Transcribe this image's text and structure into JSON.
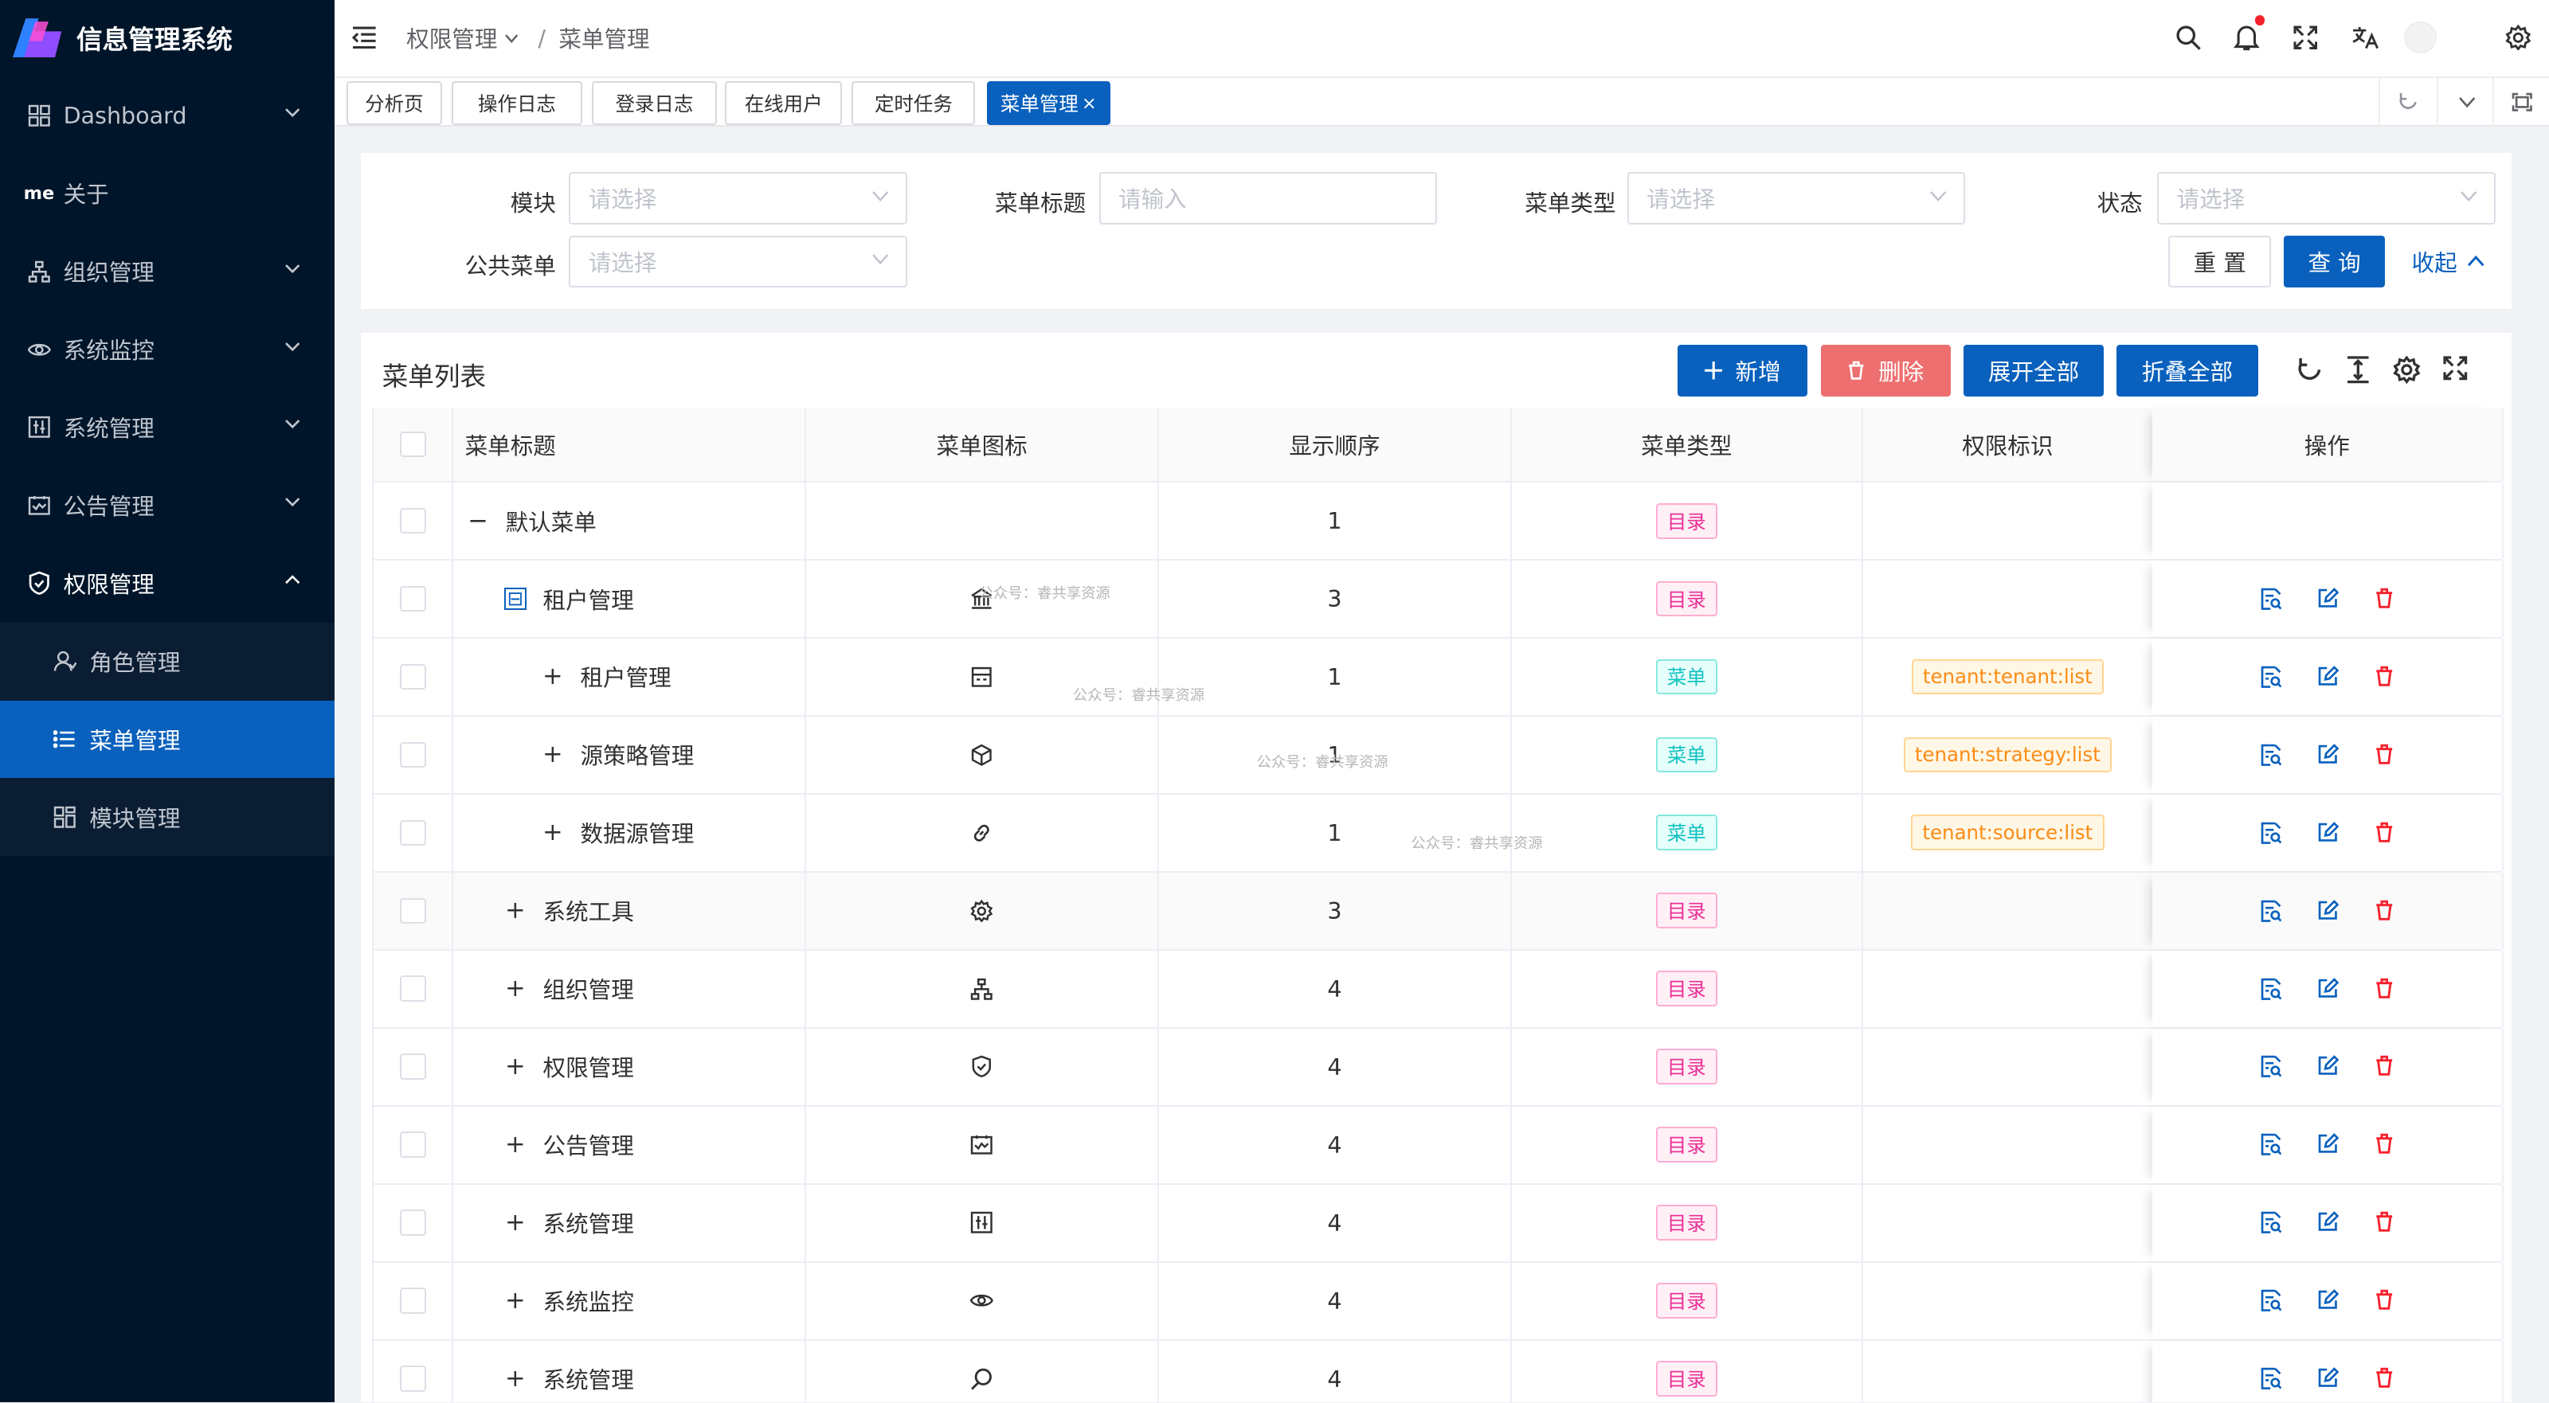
{
  "app": {
    "title": "信息管理系统"
  },
  "sidebar": {
    "items": [
      {
        "label": "Dashboard",
        "icon": "dashboard-icon"
      },
      {
        "label": "关于",
        "icon": "me-icon",
        "icon_text": "me"
      },
      {
        "label": "组织管理",
        "icon": "org-icon"
      },
      {
        "label": "系统监控",
        "icon": "eye-icon"
      },
      {
        "label": "系统管理",
        "icon": "settings-panel-icon"
      },
      {
        "label": "公告管理",
        "icon": "notice-icon"
      },
      {
        "label": "权限管理",
        "icon": "shield-icon"
      }
    ],
    "sub_items": [
      {
        "label": "角色管理",
        "icon": "user-icon"
      },
      {
        "label": "菜单管理",
        "icon": "list-icon"
      },
      {
        "label": "模块管理",
        "icon": "module-icon"
      }
    ]
  },
  "header": {
    "breadcrumb": [
      "权限管理",
      "/",
      "菜单管理"
    ]
  },
  "tabs": [
    "分析页",
    "操作日志",
    "登录日志",
    "在线用户",
    "定时任务",
    "菜单管理"
  ],
  "tab_close": "×",
  "filters": {
    "module_label": "模块",
    "module_placeholder": "请选择",
    "title_label": "菜单标题",
    "title_placeholder": "请输入",
    "type_label": "菜单类型",
    "type_placeholder": "请选择",
    "status_label": "状态",
    "status_placeholder": "请选择",
    "public_label": "公共菜单",
    "public_placeholder": "请选择",
    "reset": "重 置",
    "query": "查 询",
    "collapse": "收起"
  },
  "card": {
    "title": "菜单列表",
    "add": "新增",
    "delete": "删除",
    "expand_all": "展开全部",
    "fold_all": "折叠全部"
  },
  "table": {
    "columns": [
      "菜单标题",
      "菜单图标",
      "显示顺序",
      "菜单类型",
      "权限标识",
      "操作"
    ],
    "rows": [
      {
        "title": "默认菜单",
        "expander": "−",
        "level": 0,
        "icon": "",
        "order": "1",
        "type": "目录",
        "type_kind": "dir",
        "perm": "",
        "ops": false
      },
      {
        "title": "租户管理",
        "expander": "⊟",
        "level": 1,
        "icon": "bank",
        "order": "3",
        "type": "目录",
        "type_kind": "dir",
        "perm": "",
        "ops": true
      },
      {
        "title": "租户管理",
        "expander": "+",
        "level": 2,
        "icon": "store",
        "order": "1",
        "type": "菜单",
        "type_kind": "menu",
        "perm": "tenant:tenant:list",
        "ops": true
      },
      {
        "title": "源策略管理",
        "expander": "+",
        "level": 2,
        "icon": "cube",
        "order": "1",
        "type": "菜单",
        "type_kind": "menu",
        "perm": "tenant:strategy:list",
        "ops": true
      },
      {
        "title": "数据源管理",
        "expander": "+",
        "level": 2,
        "icon": "link",
        "order": "1",
        "type": "菜单",
        "type_kind": "menu",
        "perm": "tenant:source:list",
        "ops": true
      },
      {
        "title": "系统工具",
        "expander": "+",
        "level": 1,
        "icon": "gear",
        "order": "3",
        "type": "目录",
        "type_kind": "dir",
        "perm": "",
        "ops": true
      },
      {
        "title": "组织管理",
        "expander": "+",
        "level": 1,
        "icon": "org",
        "order": "4",
        "type": "目录",
        "type_kind": "dir",
        "perm": "",
        "ops": true
      },
      {
        "title": "权限管理",
        "expander": "+",
        "level": 1,
        "icon": "shield",
        "order": "4",
        "type": "目录",
        "type_kind": "dir",
        "perm": "",
        "ops": true
      },
      {
        "title": "公告管理",
        "expander": "+",
        "level": 1,
        "icon": "notice",
        "order": "4",
        "type": "目录",
        "type_kind": "dir",
        "perm": "",
        "ops": true
      },
      {
        "title": "系统管理",
        "expander": "+",
        "level": 1,
        "icon": "panel",
        "order": "4",
        "type": "目录",
        "type_kind": "dir",
        "perm": "",
        "ops": true
      },
      {
        "title": "系统监控",
        "expander": "+",
        "level": 1,
        "icon": "eye",
        "order": "4",
        "type": "目录",
        "type_kind": "dir",
        "perm": "",
        "ops": true
      },
      {
        "title": "系统管理",
        "expander": "+",
        "level": 1,
        "icon": "search",
        "order": "4",
        "type": "目录",
        "type_kind": "dir",
        "perm": "",
        "ops": true
      }
    ]
  },
  "watermark": "公众号：睿共享资源",
  "colors": {
    "primary": "#0960bd",
    "sidebar": "#001529",
    "danger": "#ed6f6f",
    "dir_tag": "#eb2f96",
    "menu_tag": "#13c2c2",
    "perm_tag": "#fa8c16"
  }
}
